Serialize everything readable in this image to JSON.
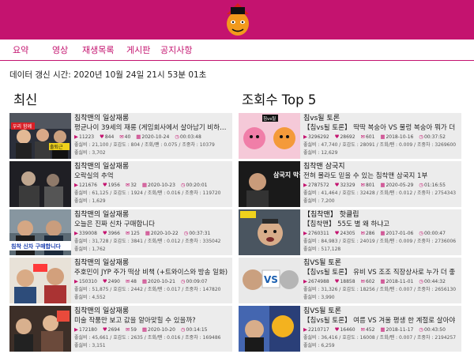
{
  "nav": {
    "items": [
      "요약",
      "영상",
      "재생목록",
      "게시판",
      "공지사항"
    ]
  },
  "updated_text": "데이터 갱신 시간: 2020년 10월 24일 21시 53분 01초",
  "sections": {
    "latest_title": "최신",
    "top_title": "조회수 Top 5"
  },
  "latest": [
    {
      "channel": "침착맨의 일상재롱",
      "title": "평균나이 39세의 재롱 (게임회사에서 살아남기 비하인드)",
      "views": "11223",
      "likes": "844",
      "comments": "40",
      "date": "2020-10-24",
      "duration": "00:03:48",
      "ratio": "좋싫비 : 21,100 / 호감도 : 804 / 조회/팬 : 0.075 / 조중차 : 10379",
      "score": "좋싫비 : 3,702"
    },
    {
      "channel": "침착맨의 일상재롱",
      "title": "오락실의 추억",
      "views": "121676",
      "likes": "1956",
      "comments": "32",
      "date": "2020-10-23",
      "duration": "00:20:01",
      "ratio": "좋싫비 : 61,125 / 호감도 : 1924 / 조회/팬 : 0.016 / 조중차 : 119720",
      "score": "좋싫비 : 1,629"
    },
    {
      "channel": "침착맨의 일상재롱",
      "title": "오늘은 진짜 신차 구매합니다",
      "views": "339008",
      "likes": "3966",
      "comments": "125",
      "date": "2020-10-22",
      "duration": "00:37:31",
      "ratio": "좋싫비 : 31,728 / 호감도 : 3841 / 조회/팬 : 0.012 / 조중차 : 335042",
      "score": "좋싫비 : 1,762"
    },
    {
      "channel": "침착맨의 일상재롱",
      "title": "주호민이 JYP 주가 떡상 비책 (+트와이스와 방송 일화)",
      "views": "150310",
      "likes": "2490",
      "comments": "48",
      "date": "2020-10-21",
      "duration": "00:09:07",
      "ratio": "좋싫비 : 51,875 / 호감도 : 2442 / 조회/팬 : 0.017 / 조중차 : 147820",
      "score": "좋싫비 : 4,552"
    },
    {
      "channel": "침착맨의 일상재롱",
      "title": "미술 작품만 보고 값을 알아맞힐 수 있을까?",
      "views": "172180",
      "likes": "2694",
      "comments": "59",
      "date": "2020-10-20",
      "duration": "00:14:15",
      "ratio": "좋싫비 : 45,661 / 호감도 : 2635 / 조회/팬 : 0.016 / 조중차 : 169486",
      "score": "좋싫비 : 3,151"
    }
  ],
  "top": [
    {
      "channel": "침vs될 토론",
      "title": "【침vs될 토론】 딱딱 복숭아 VS 물렁 복숭아 뭐가 더",
      "views": "3296292",
      "likes": "28692",
      "comments": "601",
      "date": "2018-10-16",
      "duration": "00:37:52",
      "ratio": "좋싫비 : 47,740 / 호감도 : 28091 / 조회/팬 : 0.009 / 조중차 : 3269600",
      "score": "좋싫비 : 12,629"
    },
    {
      "channel": "침착맨 삼국지",
      "title": "전혀 몰라도 믿을 수 있는 침착맨 삼국지 1부",
      "views": "2787572",
      "likes": "32329",
      "comments": "801",
      "date": "2020-05-29",
      "duration": "01:16:55",
      "ratio": "좋싫비 : 41,464 / 호감도 : 32428 / 조회/팬 : 0.012 / 조중차 : 2754343",
      "score": "좋싫비 : 7,200"
    },
    {
      "channel": "【침착맨】 핫클립",
      "title": "【침착맨】 55도 별 왜 하냐고",
      "views": "2760311",
      "likes": "24305",
      "comments": "286",
      "date": "2017-01-06",
      "duration": "00:00:47",
      "ratio": "좋싫비 : 84,983 / 호감도 : 24019 / 조회/팬 : 0.009 / 조중차 : 2736006",
      "score": "좋싫비 : 517,128"
    },
    {
      "channel": "침VS될 토론",
      "title": "【침vs될 토론】 유비 VS 조조 직장상사로 누가 더 좋",
      "views": "2674988",
      "likes": "18858",
      "comments": "602",
      "date": "2018-11-01",
      "duration": "00:44:32",
      "ratio": "좋싫비 : 31,326 / 호감도 : 18256 / 조회/팬 : 0.007 / 조중차 : 2656130",
      "score": "좋싫비 : 3,990"
    },
    {
      "channel": "침VS될 토론",
      "title": "【침vs될 토론】 여름 VS 겨울 평생 한 계절로 살아야",
      "views": "2210717",
      "likes": "16460",
      "comments": "452",
      "date": "2018-11-17",
      "duration": "00:43:50",
      "ratio": "좋싫비 : 36,416 / 호감도 : 16008 / 조회/팬 : 0.007 / 조중차 : 2194257",
      "score": "좋싫비 : 6,259"
    }
  ],
  "thumb_labels": {
    "l0a": "우리 함께",
    "l0b": "출퇴근",
    "l2": "침착 신차 구매합니다",
    "t0": "침vs될",
    "t1": "삼국지 막걸주는 남자",
    "t3": "VS"
  },
  "colors": {
    "brand": "#c4136f",
    "card": "#ececec"
  }
}
